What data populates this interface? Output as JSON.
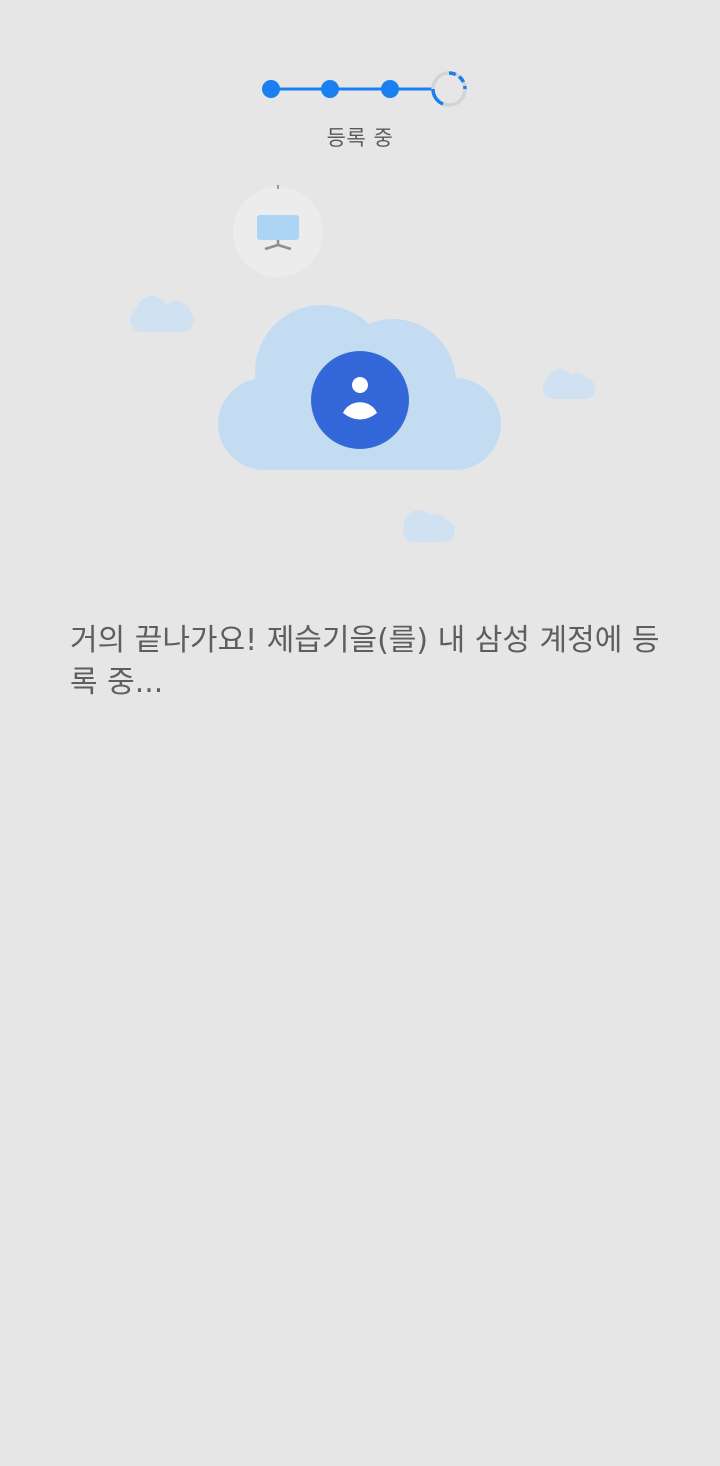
{
  "progress": {
    "total_steps": 4,
    "completed_steps": 3,
    "current_step_label": "등록 중",
    "accent_color": "#1a7ff0"
  },
  "illustration": {
    "device_icon": "tablet-icon",
    "account_icon": "account-icon",
    "cloud_color": "#c4dcf2",
    "account_circle_color": "#3468d8"
  },
  "message": {
    "text": "거의 끝나가요! 제습기을(를) 내 삼성 계정에 등록 중..."
  }
}
